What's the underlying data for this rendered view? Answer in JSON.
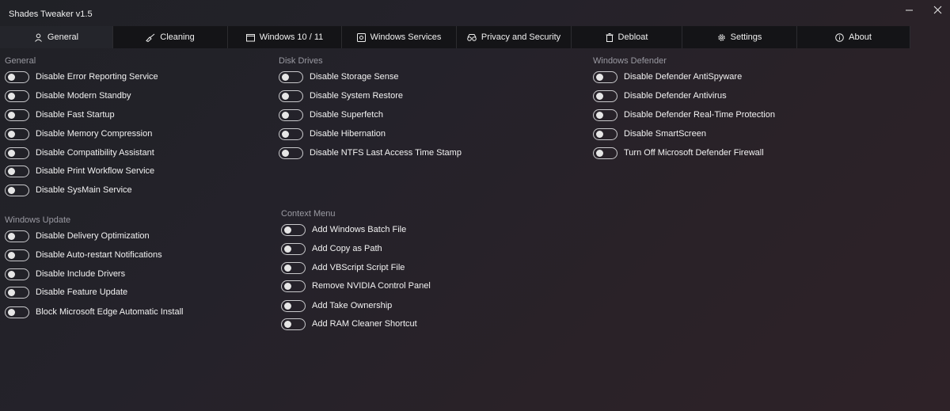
{
  "app": {
    "title": "Shades Tweaker v1.5"
  },
  "window_controls": {
    "minimize_icon": "minimize-icon",
    "close_icon": "close-icon"
  },
  "tabs": [
    {
      "label": "General",
      "icon": "person-icon",
      "active": true
    },
    {
      "label": "Cleaning",
      "icon": "broom-icon",
      "active": false
    },
    {
      "label": "Windows 10 / 11",
      "icon": "window-icon",
      "active": false
    },
    {
      "label": "Windows Services",
      "icon": "services-icon",
      "active": false
    },
    {
      "label": "Privacy and Security",
      "icon": "privacy-icon",
      "active": false
    },
    {
      "label": "Debloat",
      "icon": "trash-icon",
      "active": false
    },
    {
      "label": "Settings",
      "icon": "gear-icon",
      "active": false
    },
    {
      "label": "About",
      "icon": "info-icon",
      "active": false
    }
  ],
  "sections": {
    "general": {
      "title": "General",
      "items": [
        {
          "label": "Disable Error Reporting Service",
          "on": false
        },
        {
          "label": "Disable Modern Standby",
          "on": false
        },
        {
          "label": "Disable Fast Startup",
          "on": false
        },
        {
          "label": "Disable Memory Compression",
          "on": false
        },
        {
          "label": "Disable Compatibility Assistant",
          "on": false
        },
        {
          "label": "Disable Print Workflow Service",
          "on": false
        },
        {
          "label": "Disable SysMain Service",
          "on": false
        }
      ]
    },
    "windows_update": {
      "title": "Windows Update",
      "items": [
        {
          "label": "Disable Delivery Optimization",
          "on": false
        },
        {
          "label": "Disable Auto-restart Notifications",
          "on": false
        },
        {
          "label": "Disable Include Drivers",
          "on": false
        },
        {
          "label": "Disable Feature Update",
          "on": false
        },
        {
          "label": "Block Microsoft Edge Automatic Install",
          "on": false
        }
      ]
    },
    "disk_drives": {
      "title": "Disk Drives",
      "items": [
        {
          "label": "Disable Storage Sense",
          "on": false
        },
        {
          "label": "Disable System Restore",
          "on": false
        },
        {
          "label": "Disable Superfetch",
          "on": false
        },
        {
          "label": "Disable Hibernation",
          "on": false
        },
        {
          "label": "Disable NTFS Last Access Time Stamp",
          "on": false
        }
      ]
    },
    "context_menu": {
      "title": "Context Menu",
      "items": [
        {
          "label": "Add Windows Batch File",
          "on": false
        },
        {
          "label": "Add Copy as Path",
          "on": false
        },
        {
          "label": "Add VBScript Script File",
          "on": false
        },
        {
          "label": "Remove NVIDIA Control Panel",
          "on": false
        },
        {
          "label": "Add Take Ownership",
          "on": false
        },
        {
          "label": "Add RAM Cleaner Shortcut",
          "on": false
        }
      ]
    },
    "windows_defender": {
      "title": "Windows Defender",
      "items": [
        {
          "label": "Disable Defender AntiSpyware",
          "on": false
        },
        {
          "label": "Disable Defender Antivirus",
          "on": false
        },
        {
          "label": "Disable Defender Real-Time Protection",
          "on": false
        },
        {
          "label": "Disable SmartScreen",
          "on": false
        },
        {
          "label": "Turn Off Microsoft Defender Firewall",
          "on": false
        }
      ]
    }
  }
}
